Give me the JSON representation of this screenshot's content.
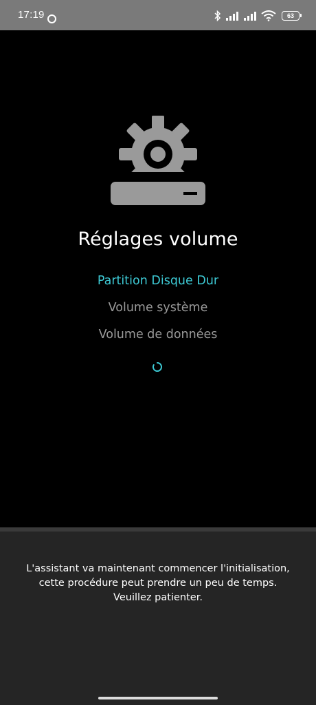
{
  "status_bar": {
    "time": "17:19",
    "battery_level": "63",
    "icons": [
      "bluetooth-icon",
      "signal-icon",
      "signal-icon",
      "wifi-icon",
      "battery-icon"
    ]
  },
  "hero": {
    "icon": "gear-drive-icon",
    "icon_color": "#9a9a9a"
  },
  "title": "Réglages volume",
  "steps": [
    {
      "label": "Partition Disque Dur",
      "state": "active"
    },
    {
      "label": "Volume système",
      "state": "pending"
    },
    {
      "label": "Volume de données",
      "state": "pending"
    }
  ],
  "spinner": {
    "icon": "loading-spinner-icon",
    "color": "#3dc9d4"
  },
  "message": {
    "lines": [
      "L'assistant va maintenant commencer l'initialisation,",
      "cette procédure peut prendre un peu de temps.",
      "Veuillez patienter."
    ]
  },
  "colors": {
    "accent": "#3dc9d4",
    "inactive_text": "#9a9a9a",
    "background": "#000000",
    "panel": "#252525",
    "status_bar": "#7a7a7a"
  }
}
